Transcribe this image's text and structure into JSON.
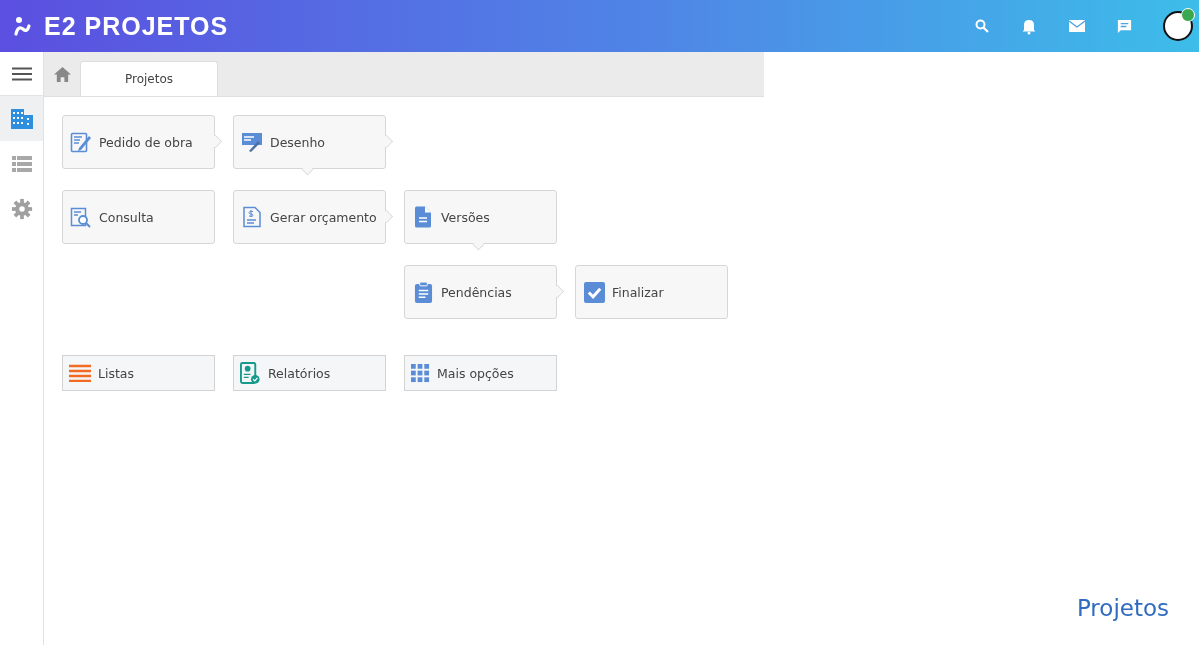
{
  "header": {
    "logo_text": "E2 PROJETOS"
  },
  "sidebar": {
    "items": [
      {
        "kind": "building",
        "selected": true
      },
      {
        "kind": "list",
        "selected": false
      },
      {
        "kind": "gear",
        "selected": false
      }
    ]
  },
  "tabs": [
    {
      "label": "Projetos",
      "selected": true
    }
  ],
  "flow": {
    "rows": [
      [
        {
          "label": "Pedido de obra",
          "kind": "form",
          "points_right": true,
          "points_down": false
        },
        {
          "label": "Desenho",
          "kind": "drawing",
          "points_right": true,
          "points_down": true
        }
      ],
      [
        {
          "label": "Consulta",
          "kind": "search",
          "points_right": false,
          "points_down": false
        },
        {
          "label": "Gerar orçamento",
          "kind": "budget",
          "points_right": true,
          "points_down": false
        },
        {
          "label": "Versões",
          "kind": "file",
          "points_right": false,
          "points_down": true
        }
      ],
      [
        null,
        null,
        {
          "label": "Pendências",
          "kind": "clipboard",
          "points_right": true,
          "points_down": false
        },
        {
          "label": "Finalizar",
          "kind": "check",
          "points_right": false,
          "points_down": false
        }
      ]
    ]
  },
  "shortcuts": [
    {
      "label": "Listas",
      "kind": "lines"
    },
    {
      "label": "Relatórios",
      "kind": "report"
    },
    {
      "label": "Mais opções",
      "kind": "grid"
    }
  ],
  "page_title": "Projetos"
}
